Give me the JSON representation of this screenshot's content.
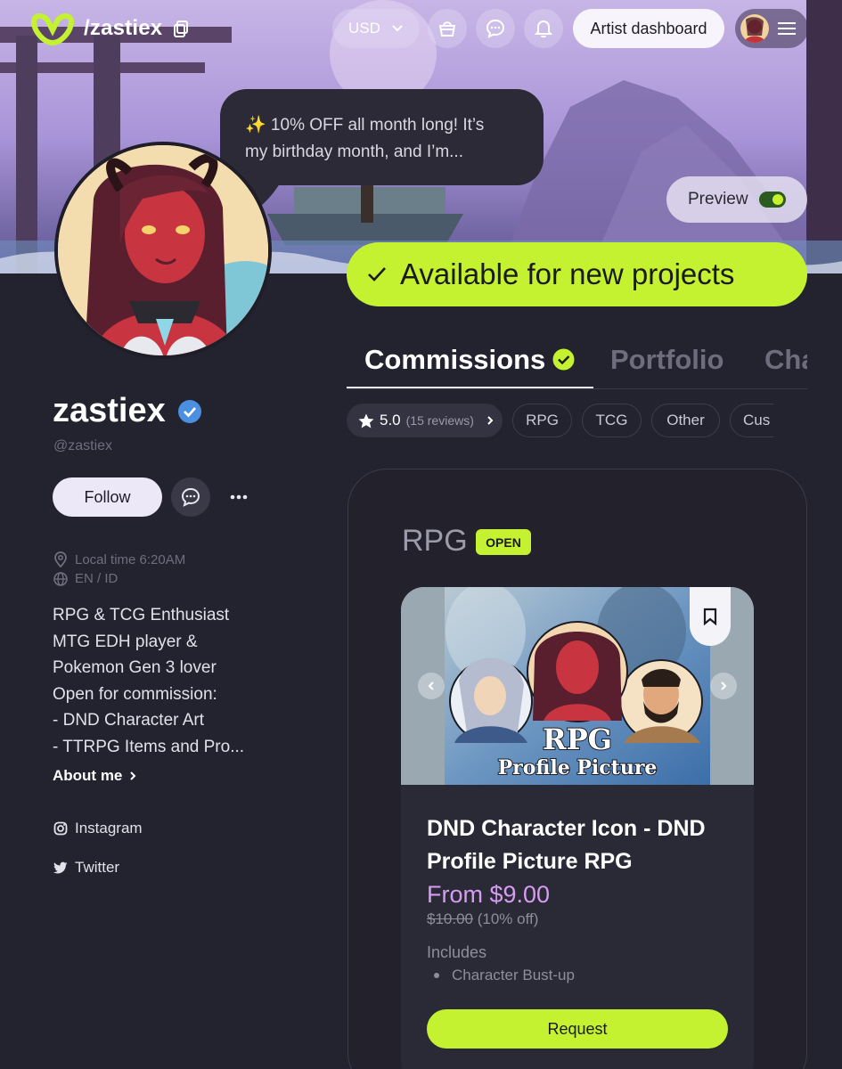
{
  "nav": {
    "handle": "/zastiex",
    "currency": "USD",
    "artist_dashboard": "Artist dashboard",
    "icons": [
      "logo-icon",
      "copy-icon",
      "chevron-down-icon",
      "basket-icon",
      "chat-icon",
      "bell-icon",
      "hamburger-icon"
    ]
  },
  "bubble": {
    "line1": "✨ 10% OFF all month long! It’s",
    "line2": "my birthday month, and I’m..."
  },
  "preview": {
    "label": "Preview",
    "toggled": true
  },
  "availability": {
    "label": "Available for new projects"
  },
  "profile": {
    "name": "zastiex",
    "handle": "@zastiex",
    "follow_label": "Follow",
    "local_time": "Local time 6:20AM",
    "languages": "EN / ID",
    "bio_lines": [
      "RPG & TCG Enthusiast",
      "MTG EDH player &",
      "Pokemon Gen 3 lover",
      "Open for commission:",
      "- DND Character Art",
      "- TTRPG Items and Pro..."
    ],
    "about_label": "About me",
    "socials": [
      {
        "label": "Instagram",
        "icon": "instagram-icon"
      },
      {
        "label": "Twitter",
        "icon": "twitter-icon"
      }
    ]
  },
  "tabs": [
    "Commissions",
    "Portfolio",
    "Cha"
  ],
  "filters": {
    "rating": "5.0",
    "reviews": "(15 reviews)",
    "chips": [
      "RPG",
      "TCG",
      "Other",
      "Cus"
    ]
  },
  "section": {
    "title": "RPG",
    "badge": "OPEN",
    "card": {
      "image_text_line1": "RPG",
      "image_text_line2": "Profile Picture",
      "title": "DND Character Icon - DND Profile Picture RPG",
      "price": "From $9.00",
      "old_price": "$10.00",
      "discount": "(10% off)",
      "includes_label": "Includes",
      "includes": [
        "Character Bust-up"
      ],
      "request_label": "Request"
    }
  },
  "colors": {
    "accent_lime": "#c4f230",
    "background": "#23222f",
    "price_purple": "#d79cf2"
  }
}
